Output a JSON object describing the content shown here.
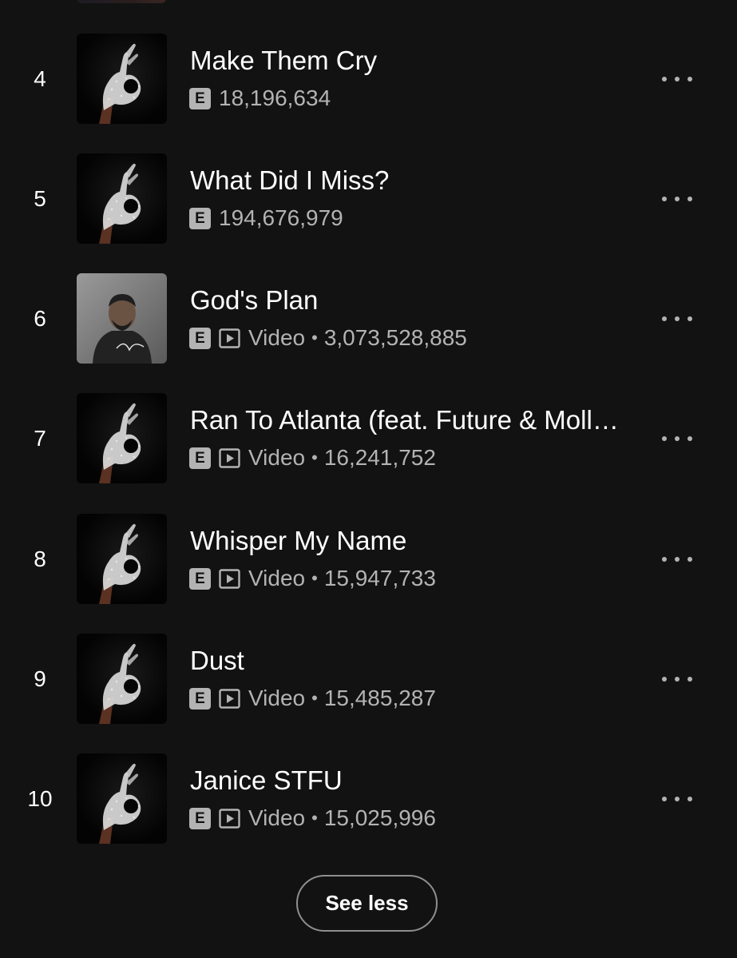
{
  "tracks": [
    {
      "rank": "4",
      "title": "Make Them Cry",
      "explicit": "E",
      "video": "",
      "separator": "",
      "plays": "18,196,634",
      "cover": "hand"
    },
    {
      "rank": "5",
      "title": "What Did I Miss?",
      "explicit": "E",
      "video": "",
      "separator": "",
      "plays": "194,676,979",
      "cover": "hand"
    },
    {
      "rank": "6",
      "title": "God's Plan",
      "explicit": "E",
      "video": "Video",
      "separator": "•",
      "plays": "3,073,528,885",
      "cover": "portrait"
    },
    {
      "rank": "7",
      "title": "Ran To Atlanta (feat. Future & Molly...",
      "explicit": "E",
      "video": "Video",
      "separator": "•",
      "plays": "16,241,752",
      "cover": "hand"
    },
    {
      "rank": "8",
      "title": "Whisper My Name",
      "explicit": "E",
      "video": "Video",
      "separator": "•",
      "plays": "15,947,733",
      "cover": "hand"
    },
    {
      "rank": "9",
      "title": "Dust",
      "explicit": "E",
      "video": "Video",
      "separator": "•",
      "plays": "15,485,287",
      "cover": "hand"
    },
    {
      "rank": "10",
      "title": "Janice STFU",
      "explicit": "E",
      "video": "Video",
      "separator": "•",
      "plays": "15,025,996",
      "cover": "hand"
    }
  ],
  "see_less_label": "See less",
  "icons": {
    "explicit": "explicit-icon",
    "video": "video-icon",
    "more": "more-options-icon"
  },
  "colors": {
    "background": "#121212",
    "primary_text": "#ffffff",
    "secondary_text": "#b3b3b3"
  }
}
